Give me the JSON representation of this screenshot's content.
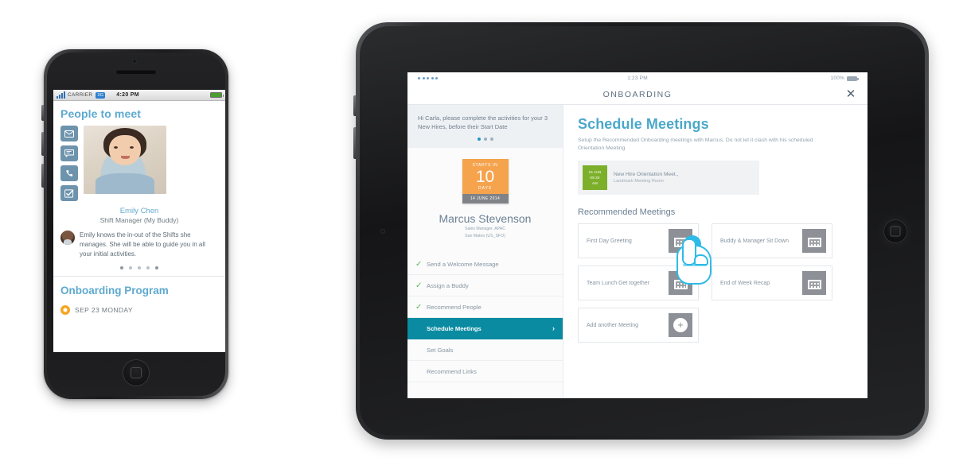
{
  "phone": {
    "status": {
      "carrier": "CARRIER",
      "wifi_badge": "3G",
      "time": "4:20 PM",
      "battery": "100%"
    },
    "heading": "People to meet",
    "actions": [
      {
        "name": "email-icon",
        "glyph": "✉"
      },
      {
        "name": "message-icon",
        "glyph": "⌨"
      },
      {
        "name": "call-icon",
        "glyph": "☎"
      },
      {
        "name": "task-icon",
        "glyph": "✓"
      }
    ],
    "person": {
      "name": "Emily Chen",
      "role": "Shift Manager (My Buddy)",
      "note": "Emily knows the in-out of the Shifts she manages. She will be able to guide you in all your initial activities."
    },
    "carousel_dots": 5,
    "carousel_active_index": 0,
    "section2": {
      "heading": "Onboarding Program",
      "date": "SEP 23 MONDAY"
    }
  },
  "tablet": {
    "status": {
      "time": "1:23 PM",
      "battery_percent": "100%"
    },
    "app_title": "ONBOARDING",
    "close_label": "✕",
    "sidebar": {
      "greeting": "Hi Carla, please complete the activities for your 3 New Hires, before their Start Date",
      "greeting_dots": 3,
      "greeting_active_index": 0,
      "starts_card": {
        "label": "STARTS IN",
        "number": "10",
        "unit": "DAYS",
        "date": "14 JUNE 2014"
      },
      "new_hire": {
        "name": "Marcus Stevenson",
        "title": "Sales Manager, APAC",
        "location": "San Mateo (US_SFO)"
      },
      "items": [
        {
          "label": "Send a Welcome Message",
          "done": true,
          "active": false
        },
        {
          "label": "Assign a Buddy",
          "done": true,
          "active": false
        },
        {
          "label": "Recommend People",
          "done": true,
          "active": false
        },
        {
          "label": "Schedule Meetings",
          "done": false,
          "active": true
        },
        {
          "label": "Set Goals",
          "done": false,
          "active": false
        },
        {
          "label": "Recommend Links",
          "done": false,
          "active": false
        }
      ],
      "check_glyph": "✓",
      "chevron_glyph": "›"
    },
    "main": {
      "heading": "Schedule Meetings",
      "subheading": "Setup the Recommended Onboarding meetings with Marcus. Do not let it clash with his scheduled Orientation Meeting",
      "scheduled_meeting": {
        "day": "15 JUN",
        "time": "09:30",
        "period": "AM",
        "title": "New Hire Orientation Meet.,",
        "location": "Landmark Meeting Room"
      },
      "section_heading": "Recommended Meetings",
      "meetings": [
        {
          "label": "First  Day Greeting",
          "icon": "calendar-icon"
        },
        {
          "label": "Buddy & Manager Sit Down",
          "icon": "calendar-icon"
        },
        {
          "label": "Team Lunch Get together",
          "icon": "calendar-icon"
        },
        {
          "label": "End of Week Recap",
          "icon": "calendar-icon"
        },
        {
          "label": "Add another Meeting",
          "icon": "plus-circle-icon"
        }
      ],
      "plus_glyph": "⊕"
    }
  },
  "colors": {
    "teal_active": "#0b8ba1",
    "heading_blue": "#4ba8c9",
    "orange": "#f5a34d",
    "green": "#7cb02b",
    "cursor_blue": "#2fbbe8"
  }
}
